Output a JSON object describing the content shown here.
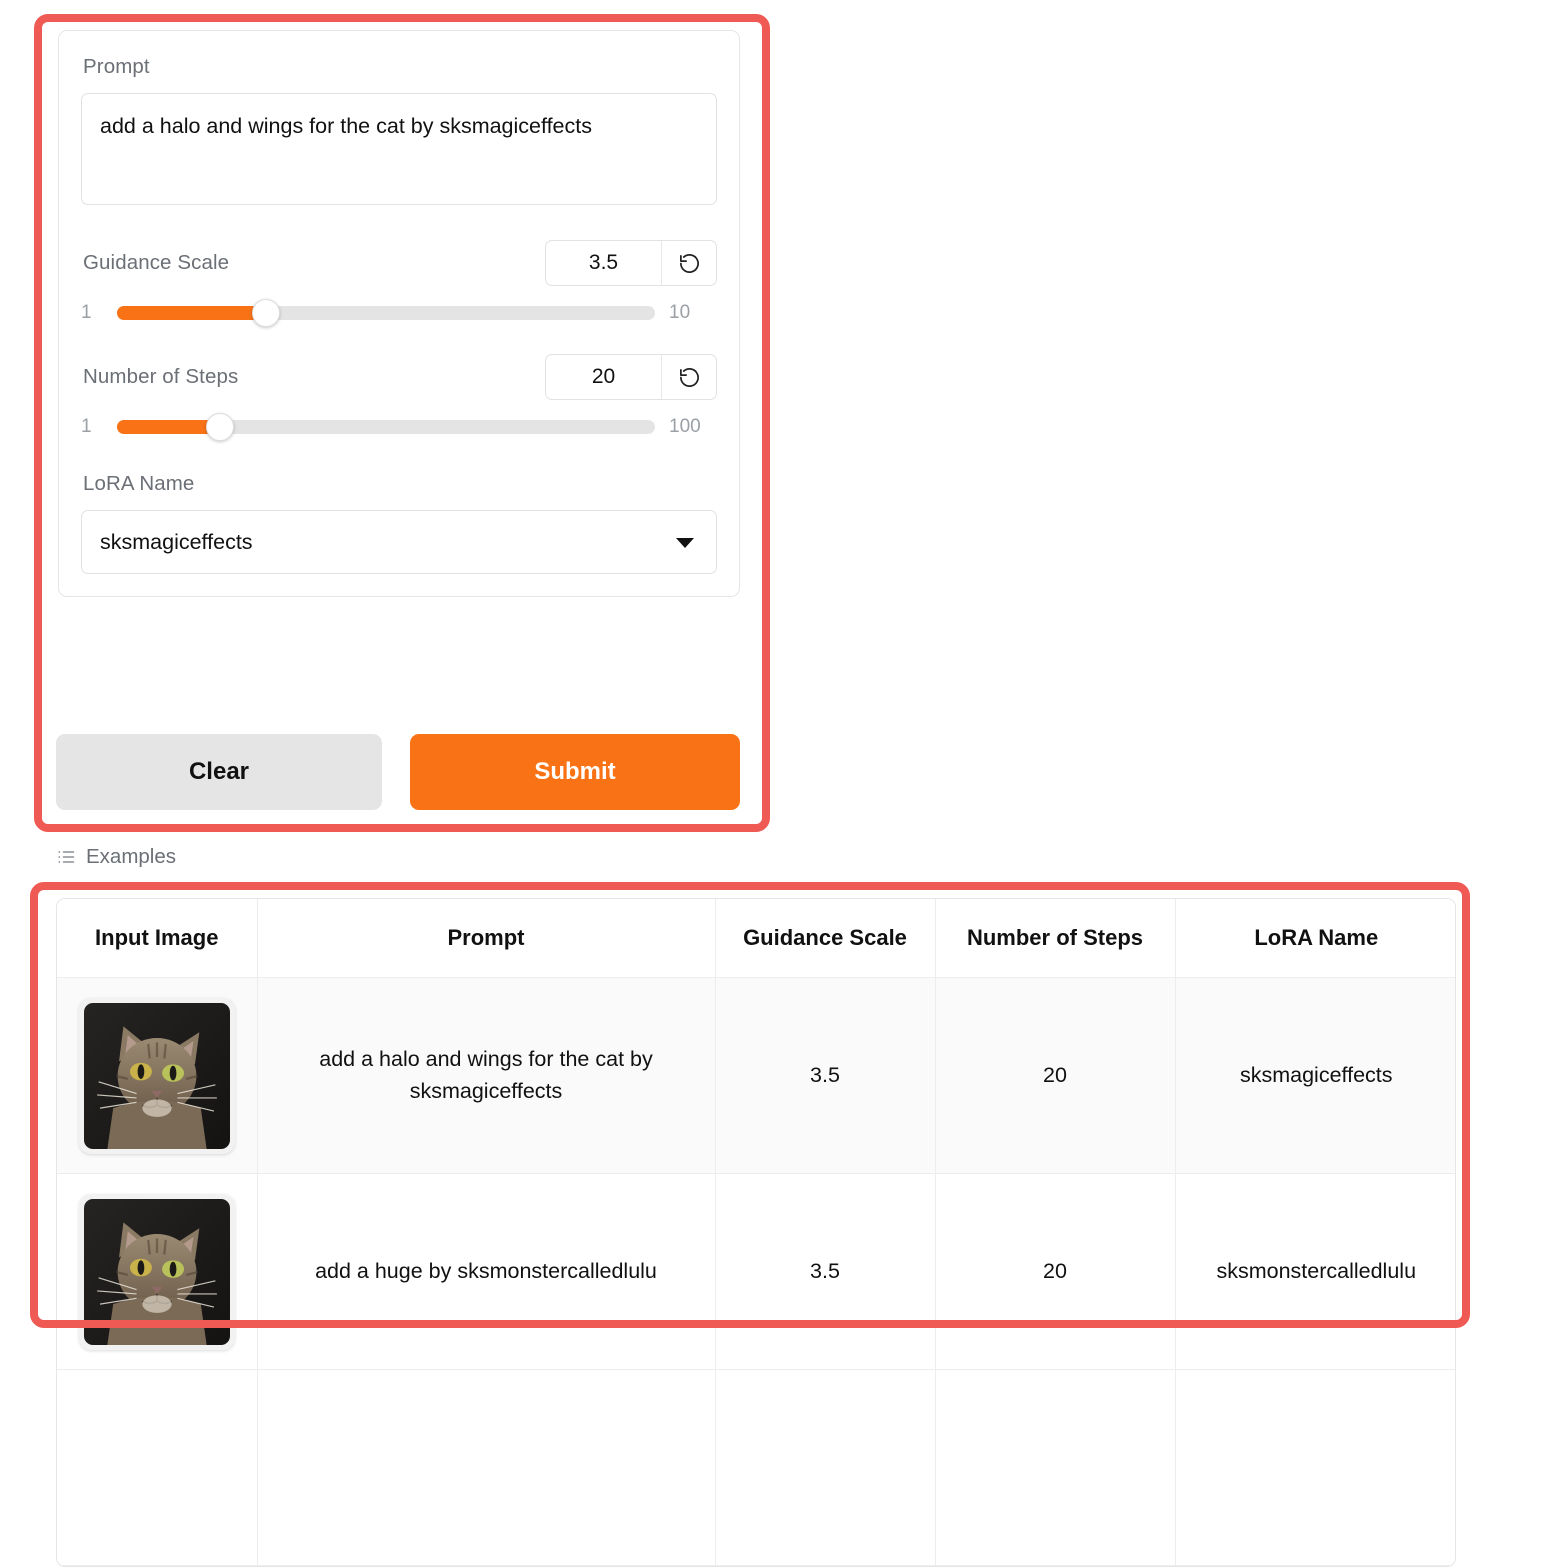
{
  "form": {
    "prompt": {
      "label": "Prompt",
      "value": "add a halo and wings for the cat by sksmagiceffects",
      "placeholder": ""
    },
    "guidance_scale": {
      "label": "Guidance Scale",
      "value": "3.5",
      "min": "1",
      "max": "10",
      "min_num": 1,
      "max_num": 10,
      "value_num": 3.5,
      "reset_icon": "reset-arrow-icon"
    },
    "number_of_steps": {
      "label": "Number of Steps",
      "value": "20",
      "min": "1",
      "max": "100",
      "min_num": 1,
      "max_num": 100,
      "value_num": 20,
      "reset_icon": "reset-arrow-icon"
    },
    "lora_name": {
      "label": "LoRA Name",
      "value": "sksmagiceffects",
      "caret_icon": "chevron-down-icon"
    }
  },
  "actions": {
    "clear_label": "Clear",
    "submit_label": "Submit"
  },
  "examples": {
    "label": "Examples",
    "icon": "list-icon",
    "columns": [
      "Input Image",
      "Prompt",
      "Guidance Scale",
      "Number of Steps",
      "LoRA Name"
    ],
    "rows": [
      {
        "image_alt": "tabby-cat-thumbnail",
        "prompt": "add a halo and wings for the cat by sksmagiceffects",
        "guidance_scale": "3.5",
        "number_of_steps": "20",
        "lora_name": "sksmagiceffects"
      },
      {
        "image_alt": "tabby-cat-thumbnail",
        "prompt": "add a huge by sksmonstercalledlulu",
        "guidance_scale": "3.5",
        "number_of_steps": "20",
        "lora_name": "sksmonstercalledlulu"
      }
    ]
  },
  "colors": {
    "accent_orange": "#f97316",
    "annotation_red": "#ef5a54",
    "track_gray": "#e4e4e4",
    "clear_gray": "#e5e5e5",
    "label_gray": "#6b6f76"
  }
}
